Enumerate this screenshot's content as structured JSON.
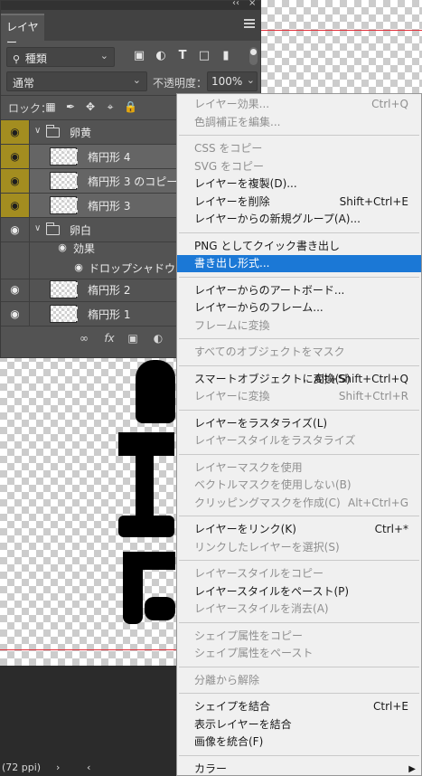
{
  "panel": {
    "tab_label": "レイヤー",
    "collapse_glyph": "‹‹",
    "close_glyph": "×",
    "kind_filter": {
      "value": "種類",
      "icon": "search-icon"
    },
    "filter_icons": [
      "image-filter-icon",
      "adjustment-filter-icon",
      "type-filter-icon",
      "shape-filter-icon",
      "smart-object-filter-icon"
    ],
    "blend_mode": "通常",
    "opacity_label": "不透明度：",
    "opacity_value": "100%",
    "lock_label": "ロック：",
    "lock_icons": [
      "lock-transparent-icon",
      "lock-paint-icon",
      "lock-position-icon",
      "lock-artboard-icon",
      "lock-all-icon"
    ],
    "layers": [
      {
        "name": "卵黄",
        "type": "group",
        "visible": true
      },
      {
        "name": "楕円形 4",
        "type": "shape",
        "visible": true,
        "selected": true
      },
      {
        "name": "楕円形 3 のコピー",
        "type": "shape",
        "visible": true,
        "selected": true
      },
      {
        "name": "楕円形 3",
        "type": "shape",
        "visible": true,
        "selected": true
      },
      {
        "name": "卵白",
        "type": "group",
        "visible": true
      },
      {
        "name": "効果",
        "type": "effects",
        "visible": true
      },
      {
        "name": "ドロップシャドウ",
        "type": "effect",
        "visible": true
      },
      {
        "name": "楕円形 2",
        "type": "shape",
        "visible": true
      },
      {
        "name": "楕円形 1",
        "type": "shape",
        "visible": true
      }
    ],
    "bottom_icons": [
      "link-icon",
      "fx-icon",
      "mask-icon",
      "adjustment-icon"
    ]
  },
  "menu": {
    "items": [
      {
        "label": "レイヤー効果...",
        "shortcut": "Ctrl+Q",
        "enabled": false
      },
      {
        "label": "色調補正を編集...",
        "shortcut": "",
        "enabled": false
      },
      {
        "separator": true
      },
      {
        "label": "CSS をコピー",
        "shortcut": "",
        "enabled": false
      },
      {
        "label": "SVG をコピー",
        "shortcut": "",
        "enabled": false
      },
      {
        "label": "レイヤーを複製(D)...",
        "shortcut": "",
        "enabled": true
      },
      {
        "label": "レイヤーを削除",
        "shortcut": "Shift+Ctrl+E",
        "enabled": true
      },
      {
        "label": "レイヤーからの新規グループ(A)...",
        "shortcut": "",
        "enabled": true
      },
      {
        "separator": true
      },
      {
        "label": "PNG としてクイック書き出し",
        "shortcut": "",
        "enabled": true
      },
      {
        "label": "書き出し形式...",
        "shortcut": "",
        "enabled": true,
        "highlighted": true
      },
      {
        "separator": true
      },
      {
        "label": "レイヤーからのアートボード...",
        "shortcut": "",
        "enabled": true
      },
      {
        "label": "レイヤーからのフレーム...",
        "shortcut": "",
        "enabled": true
      },
      {
        "label": "フレームに変換",
        "shortcut": "",
        "enabled": false
      },
      {
        "separator": true
      },
      {
        "label": "すべてのオブジェクトをマスク",
        "shortcut": "",
        "enabled": false
      },
      {
        "separator": true
      },
      {
        "label": "スマートオブジェクトに変換(S)",
        "shortcut": "Alt+Shift+Ctrl+Q",
        "enabled": true
      },
      {
        "label": "レイヤーに変換",
        "shortcut": "Shift+Ctrl+R",
        "enabled": false
      },
      {
        "separator": true
      },
      {
        "label": "レイヤーをラスタライズ(L)",
        "shortcut": "",
        "enabled": true
      },
      {
        "label": "レイヤースタイルをラスタライズ",
        "shortcut": "",
        "enabled": false
      },
      {
        "separator": true
      },
      {
        "label": "レイヤーマスクを使用",
        "shortcut": "",
        "enabled": false
      },
      {
        "label": "ベクトルマスクを使用しない(B)",
        "shortcut": "",
        "enabled": false
      },
      {
        "label": "クリッピングマスクを作成(C)",
        "shortcut": "Alt+Ctrl+G",
        "enabled": false
      },
      {
        "separator": true
      },
      {
        "label": "レイヤーをリンク(K)",
        "shortcut": "Ctrl+*",
        "enabled": true
      },
      {
        "label": "リンクしたレイヤーを選択(S)",
        "shortcut": "",
        "enabled": false
      },
      {
        "separator": true
      },
      {
        "label": "レイヤースタイルをコピー",
        "shortcut": "",
        "enabled": false
      },
      {
        "label": "レイヤースタイルをペースト(P)",
        "shortcut": "",
        "enabled": true
      },
      {
        "label": "レイヤースタイルを消去(A)",
        "shortcut": "",
        "enabled": false
      },
      {
        "separator": true
      },
      {
        "label": "シェイプ属性をコピー",
        "shortcut": "",
        "enabled": false
      },
      {
        "label": "シェイプ属性をペースト",
        "shortcut": "",
        "enabled": false
      },
      {
        "separator": true
      },
      {
        "label": "分離から解除",
        "shortcut": "",
        "enabled": false
      },
      {
        "separator": true
      },
      {
        "label": "シェイプを結合",
        "shortcut": "Ctrl+E",
        "enabled": true
      },
      {
        "label": "表示レイヤーを結合",
        "shortcut": "",
        "enabled": true
      },
      {
        "label": "画像を統合(F)",
        "shortcut": "",
        "enabled": true
      },
      {
        "separator": true
      },
      {
        "label": "カラー",
        "shortcut": "",
        "enabled": true,
        "submenu": true
      }
    ]
  },
  "status": {
    "zoom_info": "(72 ppi)",
    "arrow": "›",
    "more": "‹"
  },
  "colors": {
    "highlight": "#1b78d6",
    "eye_selected": "#a38d20",
    "guide": "#e0303a"
  }
}
